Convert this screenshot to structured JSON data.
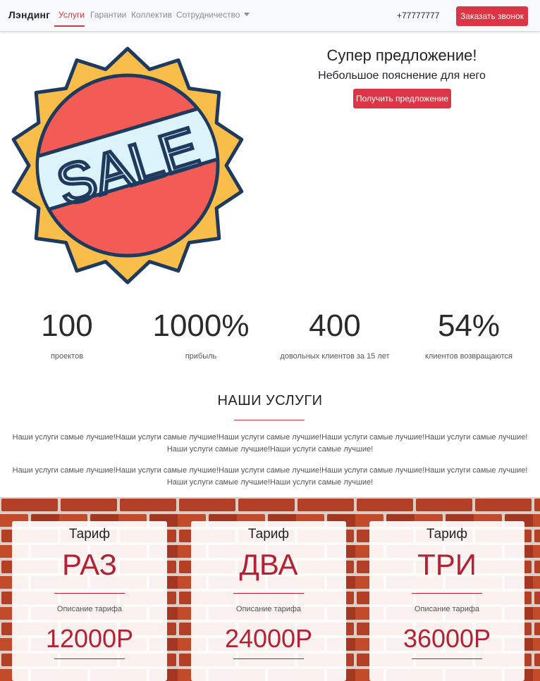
{
  "navbar": {
    "brand": "Лэндинг",
    "links": [
      "Услуги",
      "Гарантии",
      "Коллектив",
      "Сотрудничество"
    ],
    "phone": "+77777777",
    "call_button": "Заказать звонок"
  },
  "hero": {
    "title": "Супер предложение!",
    "subtitle": "Небольшое пояснение для него",
    "cta": "Получить предложение",
    "sale_text": "SALE"
  },
  "stats": [
    {
      "value": "100",
      "label": "проектов"
    },
    {
      "value": "1000%",
      "label": "прибыль"
    },
    {
      "value": "400",
      "label": "довольных клиентов за 15 лет"
    },
    {
      "value": "54%",
      "label": "клиентов возвращаются"
    }
  ],
  "services": {
    "title": "НАШИ УСЛУГИ",
    "paragraphs": [
      "Наши услуги самые лучшие!Наши услуги самые лучшие!Наши услуги самые лучшие!Наши услуги самые лучшие!Наши услуги самые лучшие!Наши услуги самые лучшие!Наши услуги самые лучшие!",
      "Наши услуги самые лучшие!Наши услуги самые лучшие!Наши услуги самые лучшие!Наши услуги самые лучшие!Наши услуги самые лучшие!Наши услуги самые лучшие!Наши услуги самые лучшие!"
    ]
  },
  "pricing": {
    "cards": [
      {
        "top": "Тариф",
        "name": "РАЗ",
        "desc": "Описание тарифа",
        "price": "12000Р"
      },
      {
        "top": "Тариф",
        "name": "ДВА",
        "desc": "Описание тарифа",
        "price": "24000Р"
      },
      {
        "top": "Тариф",
        "name": "ТРИ",
        "desc": "Описание тарифа",
        "price": "36000Р"
      }
    ]
  },
  "colors": {
    "accent": "#dc3545",
    "price_red": "#b22234",
    "badge_orange": "#f9bd4a",
    "badge_red": "#f25c54",
    "badge_blue": "#ddf3fa",
    "badge_outline": "#1e3a5f"
  }
}
